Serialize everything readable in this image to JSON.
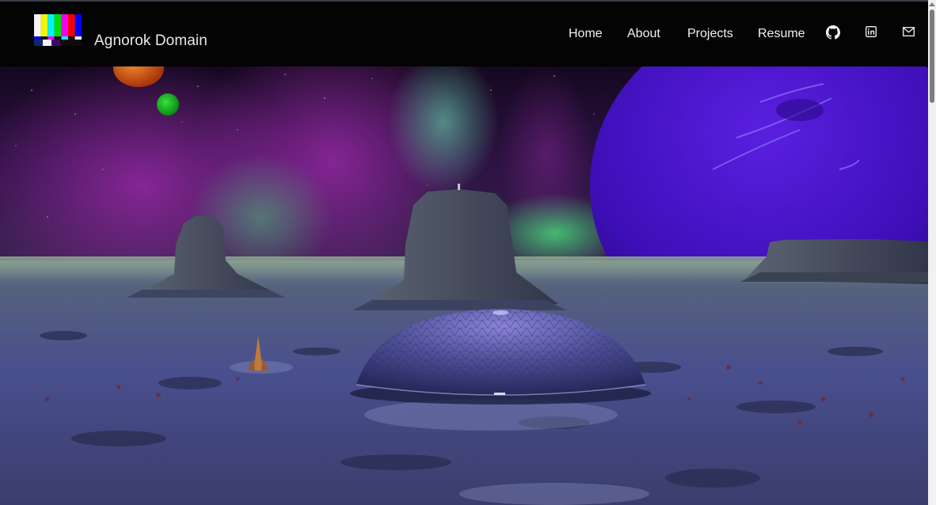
{
  "site": {
    "brand": "Agnorok Domain"
  },
  "nav": {
    "links": [
      {
        "label": "Home"
      },
      {
        "label": "About"
      },
      {
        "label": "Projects"
      },
      {
        "label": "Resume"
      }
    ],
    "icons": [
      "github-icon",
      "linkedin-icon",
      "mail-icon"
    ]
  },
  "colors": {
    "navbar_bg": "#040404",
    "nav_text": "#f2f2f2",
    "planet_purple": "#4a14c8",
    "aurora_green": "#3fbf6a",
    "ground_blue": "#4a4f8e"
  },
  "hero": {
    "description_icon": "alien-landscape-illustration"
  }
}
